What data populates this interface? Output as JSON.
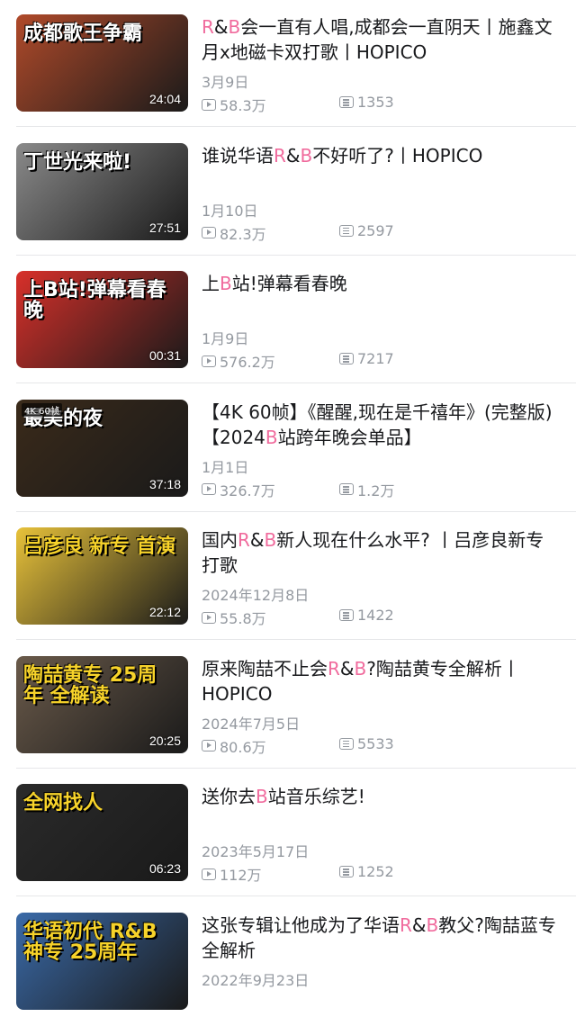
{
  "videos": [
    {
      "title_parts": [
        [
          "R",
          "hl"
        ],
        [
          "&",
          ""
        ],
        [
          "B",
          "hl"
        ],
        [
          "会一直有人唱,成都会一直阴天丨施鑫文月x地磁卡双打歌丨HOPICO",
          ""
        ]
      ],
      "date": "3月9日",
      "plays": "58.3万",
      "danmaku": "1353",
      "duration": "24:04",
      "thumb_text": "成都歌王争霸",
      "thumb_color": "#b04a2a"
    },
    {
      "title_parts": [
        [
          "谁说华语",
          ""
        ],
        [
          "R",
          "hl"
        ],
        [
          "&",
          ""
        ],
        [
          "B",
          "hl"
        ],
        [
          "不好听了?丨HOPICO",
          ""
        ]
      ],
      "date": "1月10日",
      "plays": "82.3万",
      "danmaku": "2597",
      "duration": "27:51",
      "thumb_text": "丁世光来啦!",
      "thumb_color": "#8a8a8a"
    },
    {
      "title_parts": [
        [
          "上",
          ""
        ],
        [
          "B",
          "hl"
        ],
        [
          "站!弹幕看春晚",
          ""
        ]
      ],
      "date": "1月9日",
      "plays": "576.2万",
      "danmaku": "7217",
      "duration": "00:31",
      "thumb_text": "上B站!弹幕看春晚",
      "thumb_color": "#d8302a"
    },
    {
      "title_parts": [
        [
          "【4K 60帧】《醒醒,现在是千禧年》(完整版)【2024",
          ""
        ],
        [
          "B",
          "hl"
        ],
        [
          "站跨年晚会单品】",
          ""
        ]
      ],
      "date": "1月1日",
      "plays": "326.7万",
      "danmaku": "1.2万",
      "duration": "37:18",
      "thumb_text": "最美的夜",
      "thumb_color": "#3a2a1a",
      "thumb_badge": "4K 60帧"
    },
    {
      "title_parts": [
        [
          "国内",
          ""
        ],
        [
          "R",
          "hl"
        ],
        [
          "&",
          ""
        ],
        [
          "B",
          "hl"
        ],
        [
          "新人现在什么水平? 丨吕彦良新专打歌",
          ""
        ]
      ],
      "date": "2024年12月8日",
      "plays": "55.8万",
      "danmaku": "1422",
      "duration": "22:12",
      "thumb_text": "吕彦良 新专 首演",
      "thumb_color": "#e8c23a"
    },
    {
      "title_parts": [
        [
          "原来陶喆不止会",
          ""
        ],
        [
          "R",
          "hl"
        ],
        [
          "&",
          ""
        ],
        [
          "B",
          "hl"
        ],
        [
          "?陶喆黄专全解析丨HOPICO",
          ""
        ]
      ],
      "date": "2024年7月5日",
      "plays": "80.6万",
      "danmaku": "5533",
      "duration": "20:25",
      "thumb_text": "陶喆黄专 25周年 全解读",
      "thumb_color": "#6a5a4a"
    },
    {
      "title_parts": [
        [
          "送你去",
          ""
        ],
        [
          "B",
          "hl"
        ],
        [
          "站音乐综艺!",
          ""
        ]
      ],
      "date": "2023年5月17日",
      "plays": "112万",
      "danmaku": "1252",
      "duration": "06:23",
      "thumb_text": "全网找人",
      "thumb_color": "#2a2a2a"
    },
    {
      "title_parts": [
        [
          "这张专辑让他成为了华语",
          ""
        ],
        [
          "R",
          "hl"
        ],
        [
          "&",
          ""
        ],
        [
          "B",
          "hl"
        ],
        [
          "教父?陶喆蓝专全解析",
          ""
        ]
      ],
      "date": "2022年9月23日",
      "plays": "",
      "danmaku": "",
      "duration": "",
      "thumb_text": "华语初代 R&B神专 25周年",
      "thumb_color": "#3a6aa8"
    }
  ]
}
